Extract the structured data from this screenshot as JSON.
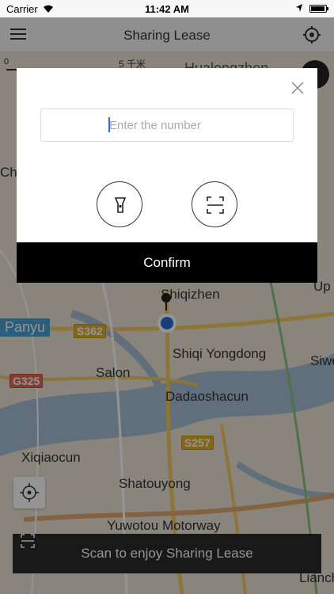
{
  "status": {
    "carrier": "Carrier",
    "time": "11:42 AM"
  },
  "nav": {
    "title": "Sharing Lease"
  },
  "map": {
    "places": [
      "Shiqizhen",
      "Shiqi Yongdong",
      "Salon",
      "Dadaoshacun",
      "Xiqiaocun",
      "Shatouyong",
      "Yuwotou Motorway",
      "Panyu",
      "Hualongzhen",
      "Siwo",
      "Lianchan",
      "Up",
      "Cha"
    ],
    "roads": [
      "S362",
      "G325",
      "S257"
    ],
    "scale": "5 千米",
    "scale_start": "0"
  },
  "dialog": {
    "placeholder": "Enter the number",
    "confirm_label": "Confirm"
  },
  "scan_bar": {
    "label": "Scan to enjoy Sharing Lease"
  },
  "colors": {
    "accent": "#3a6fd8",
    "confirm_bg": "#000000"
  }
}
